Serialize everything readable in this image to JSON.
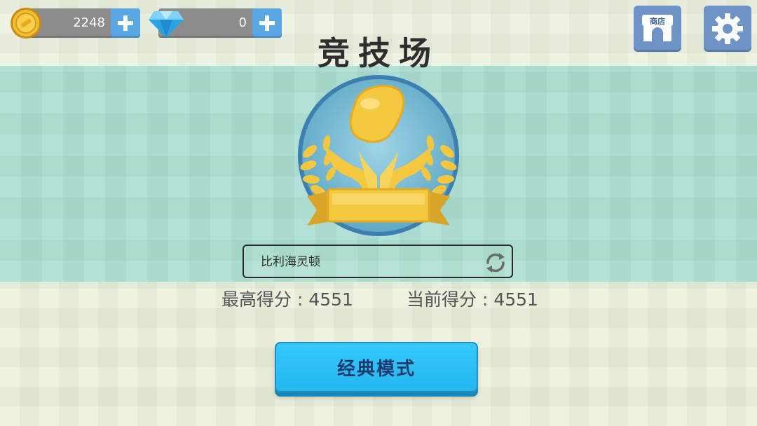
{
  "currency": {
    "coins": "2248",
    "gems": "0"
  },
  "header": {
    "title": "竞技场",
    "shop_label": "商店"
  },
  "player": {
    "name": "比利海灵顿"
  },
  "scores": {
    "best_label": "最高得分 : ",
    "best_value": "4551",
    "current_label": "当前得分 : ",
    "current_value": "4551"
  },
  "mode": {
    "button_label": "经典模式"
  },
  "colors": {
    "band": "#a9ddd1",
    "button_blue": "#2ec0f7",
    "corner_button": "#6d93c7",
    "gold": "#f5c842"
  },
  "icons": [
    "coin-icon",
    "diamond-icon",
    "plus-icon",
    "shop-icon",
    "gear-icon",
    "laurel-hands-emblem-icon",
    "refresh-icon"
  ]
}
